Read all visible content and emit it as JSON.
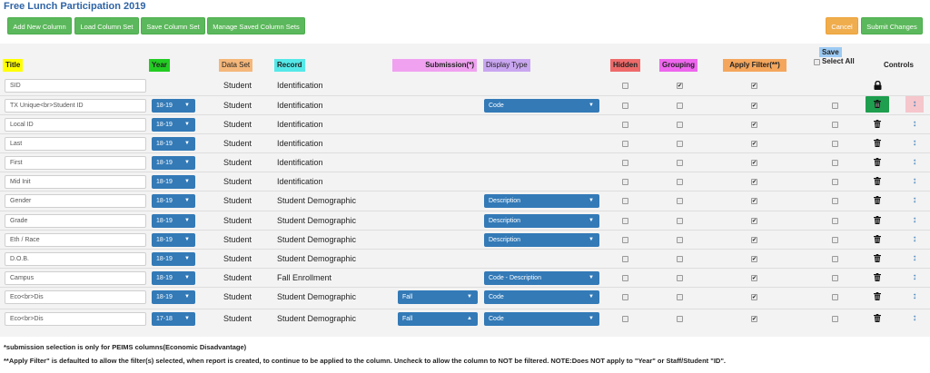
{
  "title": "Free Lunch Participation 2019",
  "toolbar": {
    "add_new_column": "Add New Column",
    "load_column_set": "Load Column Set",
    "save_column_set": "Save Column Set",
    "manage_saved_column_sets": "Manage Saved Column Sets",
    "cancel": "Cancel",
    "submit_changes": "Submit Changes"
  },
  "headers": {
    "title": "Title",
    "year": "Year",
    "data_set": "Data Set",
    "record": "Record",
    "submission": "Submission(*)",
    "display_type": "Display Type",
    "hidden": "Hidden",
    "grouping": "Grouping",
    "apply_filter": "Apply Filter(**)",
    "save": "Save",
    "select_all": "Select All",
    "controls": "Controls"
  },
  "header_colors": {
    "title": "#ffff00",
    "year": "#22cc22",
    "data_set": "#f5b77a",
    "record": "#55e8e8",
    "submission": "#f0a2f0",
    "display_type": "#c9a6f0",
    "hidden": "#ef6a6a",
    "grouping": "#ee66ee",
    "apply_filter": "#f4a65c",
    "save": "#9ccaf3"
  },
  "rows": [
    {
      "title": "SID",
      "year": "",
      "data_set": "Student",
      "record": "Identification",
      "submission": "",
      "display_type": "",
      "hidden": false,
      "grouping": true,
      "apply_filter": true,
      "save": null,
      "control": "lock"
    },
    {
      "title": "TX Unique<br>Student ID",
      "year": "18-19",
      "data_set": "Student",
      "record": "Identification",
      "submission": "",
      "display_type": "Code",
      "hidden": false,
      "grouping": false,
      "apply_filter": true,
      "save": false,
      "control": "trash-highlight"
    },
    {
      "title": "Local ID",
      "year": "18-19",
      "data_set": "Student",
      "record": "Identification",
      "submission": "",
      "display_type": "",
      "hidden": false,
      "grouping": false,
      "apply_filter": true,
      "save": false,
      "control": "trash"
    },
    {
      "title": "Last",
      "year": "18-19",
      "data_set": "Student",
      "record": "Identification",
      "submission": "",
      "display_type": "",
      "hidden": false,
      "grouping": false,
      "apply_filter": true,
      "save": false,
      "control": "trash"
    },
    {
      "title": "First",
      "year": "18-19",
      "data_set": "Student",
      "record": "Identification",
      "submission": "",
      "display_type": "",
      "hidden": false,
      "grouping": false,
      "apply_filter": true,
      "save": false,
      "control": "trash"
    },
    {
      "title": "Mid Init",
      "year": "18-19",
      "data_set": "Student",
      "record": "Identification",
      "submission": "",
      "display_type": "",
      "hidden": false,
      "grouping": false,
      "apply_filter": true,
      "save": false,
      "control": "trash"
    },
    {
      "title": "Gender",
      "year": "18-19",
      "data_set": "Student",
      "record": "Student Demographic",
      "submission": "",
      "display_type": "Description",
      "hidden": false,
      "grouping": false,
      "apply_filter": true,
      "save": false,
      "control": "trash"
    },
    {
      "title": "Grade",
      "year": "18-19",
      "data_set": "Student",
      "record": "Student Demographic",
      "submission": "",
      "display_type": "Description",
      "hidden": false,
      "grouping": false,
      "apply_filter": true,
      "save": false,
      "control": "trash"
    },
    {
      "title": "Eth / Race",
      "year": "18-19",
      "data_set": "Student",
      "record": "Student Demographic",
      "submission": "",
      "display_type": "Description",
      "hidden": false,
      "grouping": false,
      "apply_filter": true,
      "save": false,
      "control": "trash"
    },
    {
      "title": "D.O.B.",
      "year": "18-19",
      "data_set": "Student",
      "record": "Student Demographic",
      "submission": "",
      "display_type": "",
      "hidden": false,
      "grouping": false,
      "apply_filter": true,
      "save": false,
      "control": "trash"
    },
    {
      "title": "Campus",
      "year": "18-19",
      "data_set": "Student",
      "record": "Fall Enrollment",
      "submission": "",
      "display_type": "Code - Description",
      "hidden": false,
      "grouping": false,
      "apply_filter": true,
      "save": false,
      "control": "trash"
    },
    {
      "title": "Eco<br>Dis",
      "year": "18-19",
      "data_set": "Student",
      "record": "Student Demographic",
      "submission": "Fall",
      "submission_caret": "▼",
      "display_type": "Code",
      "hidden": false,
      "grouping": false,
      "apply_filter": true,
      "save": false,
      "control": "trash"
    },
    {
      "title": "Eco<br>Dis",
      "year": "17-18",
      "data_set": "Student",
      "record": "Student Demographic",
      "submission": "Fall",
      "submission_caret": "▲",
      "display_type": "Code",
      "hidden": false,
      "grouping": false,
      "apply_filter": true,
      "save": false,
      "control": "trash"
    }
  ],
  "notes": {
    "submission_note": "*submission selection is only for PEIMS columns(Economic Disadvantage)",
    "filter_note": "**Apply Filter\" is defaulted to allow the filter(s) selected, when report is created, to continue to be applied to the column. Uncheck to allow the column to NOT be filtered. NOTE:Does NOT apply to \"Year\" or Staff/Student \"ID\"."
  },
  "icons": {
    "lock": "lock-icon",
    "trash": "trash-icon",
    "move": "move-icon",
    "caret": "caret-down-icon"
  }
}
